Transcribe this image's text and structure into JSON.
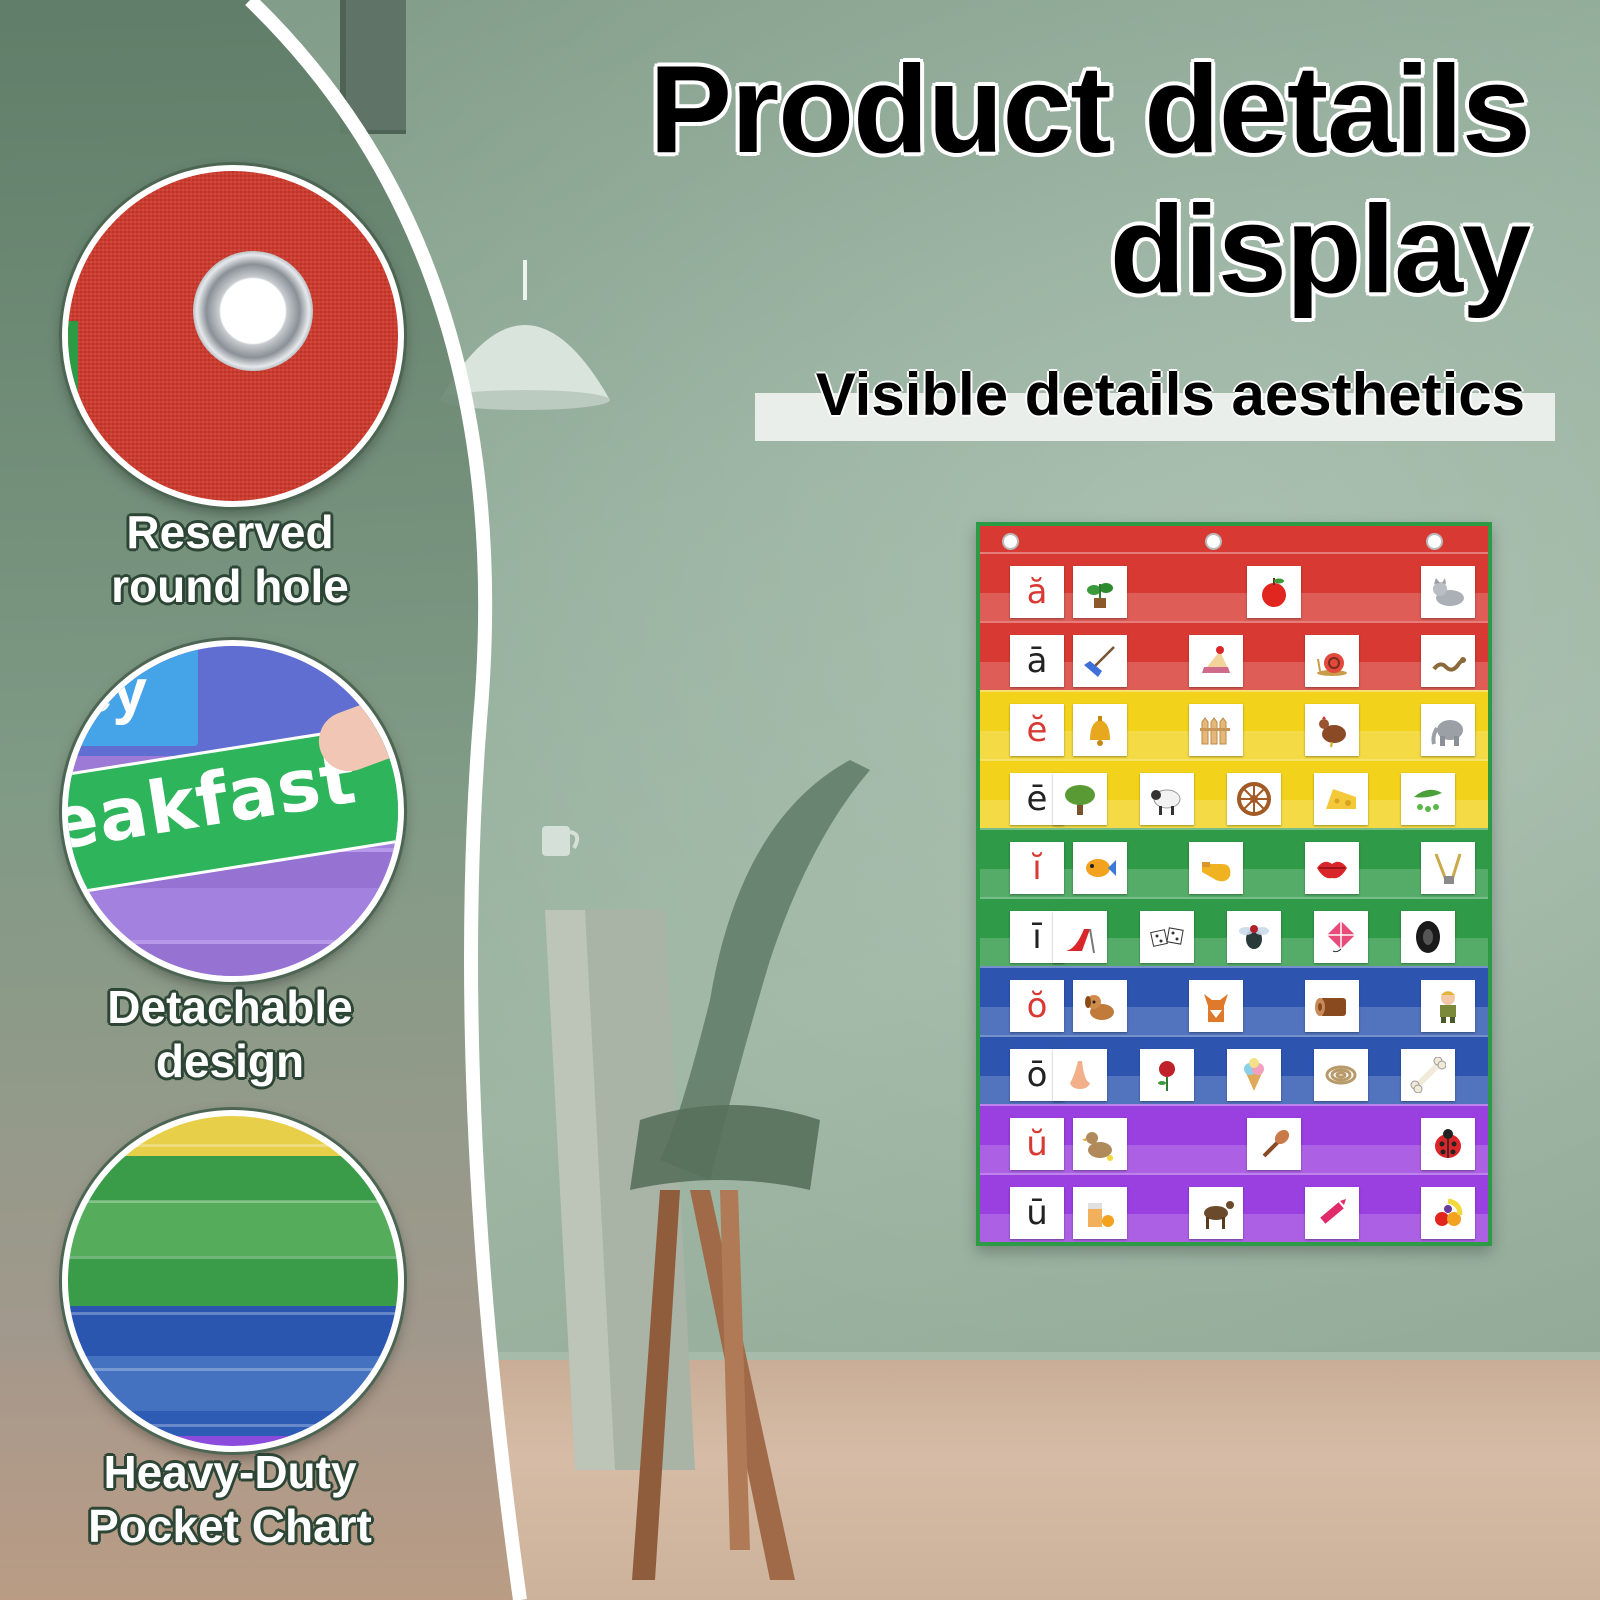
{
  "headline": {
    "title_line1": "Product details",
    "title_line2": "display",
    "subtitle": "Visible details aesthetics"
  },
  "features": [
    {
      "caption_line1": "Reserved",
      "caption_line2": "round hole"
    },
    {
      "caption_line1": "Detachable",
      "caption_line2": "design",
      "card_text": "eakfast",
      "blue_card_text": "ey"
    },
    {
      "caption_line1": "Heavy-Duty",
      "caption_line2": "Pocket Chart"
    }
  ],
  "pocket_chart": {
    "rows": [
      {
        "letter": "ă",
        "band_color": "#d83a33",
        "letter_color": "#d83a33",
        "icons": [
          "plant-icon",
          "apple-icon",
          "cat-icon"
        ]
      },
      {
        "letter": "ā",
        "band_color": "#d83a33",
        "letter_color": "#222222",
        "icons": [
          "rake-icon",
          "cake-icon",
          "snail-icon",
          "snake-icon"
        ]
      },
      {
        "letter": "ĕ",
        "band_color": "#f2d21b",
        "letter_color": "#d83a33",
        "icons": [
          "bell-icon",
          "fence-icon",
          "hen-icon",
          "elephant-icon"
        ]
      },
      {
        "letter": "ē",
        "band_color": "#f2d21b",
        "letter_color": "#222222",
        "icons": [
          "tree-icon",
          "sheep-icon",
          "wheel-icon",
          "cheese-icon",
          "peas-icon"
        ]
      },
      {
        "letter": "ĭ",
        "band_color": "#2f9a47",
        "letter_color": "#d83a33",
        "icons": [
          "fish-icon",
          "whistle-icon",
          "lips-icon",
          "zipper-icon"
        ]
      },
      {
        "letter": "ī",
        "band_color": "#2f9a47",
        "letter_color": "#222222",
        "icons": [
          "slide-icon",
          "dice-icon",
          "fly-icon",
          "kite-icon",
          "tire-icon"
        ]
      },
      {
        "letter": "ŏ",
        "band_color": "#2d55b0",
        "letter_color": "#d83a33",
        "icons": [
          "dog-icon",
          "fox-icon",
          "log-icon",
          "boy-icon"
        ]
      },
      {
        "letter": "ō",
        "band_color": "#2d55b0",
        "letter_color": "#222222",
        "icons": [
          "nose-icon",
          "rose-icon",
          "ice-cream-icon",
          "rope-icon",
          "bone-icon"
        ]
      },
      {
        "letter": "ŭ",
        "band_color": "#9a3fe0",
        "letter_color": "#d83a33",
        "icons": [
          "duck-icon",
          "brush-icon",
          "ladybug-icon"
        ]
      },
      {
        "letter": "ū",
        "band_color": "#9a3fe0",
        "letter_color": "#222222",
        "icons": [
          "juice-icon",
          "mule-icon",
          "crayon-icon",
          "fruit-icon"
        ]
      }
    ]
  }
}
